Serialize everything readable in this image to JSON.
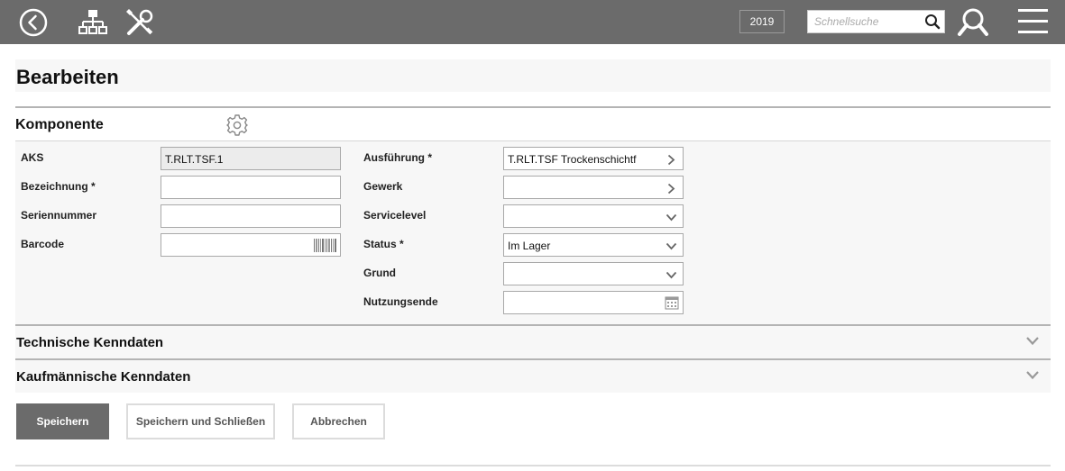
{
  "topbar": {
    "year": "2019",
    "search_placeholder": "Schnellsuche",
    "icons": [
      "back-circle-icon",
      "hierarchy-icon",
      "tools-icon",
      "search-icon",
      "advanced-search-icon",
      "menu-icon"
    ]
  },
  "page": {
    "title": "Bearbeiten"
  },
  "komponente": {
    "title": "Komponente",
    "fields_left": [
      {
        "label": "AKS",
        "value": "T.RLT.TSF.1"
      },
      {
        "label": "Bezeichnung *",
        "value": ""
      },
      {
        "label": "Seriennummer",
        "value": ""
      },
      {
        "label": "Barcode",
        "value": ""
      }
    ],
    "fields_right": [
      {
        "label": "Ausführung *",
        "value": "T.RLT.TSF Trockenschichtf"
      },
      {
        "label": "Gewerk",
        "value": ""
      },
      {
        "label": "Servicelevel",
        "value": ""
      },
      {
        "label": "Status *",
        "value": "Im Lager"
      },
      {
        "label": "Grund",
        "value": ""
      },
      {
        "label": "Nutzungsende",
        "value": ""
      }
    ]
  },
  "sections": {
    "technische": "Technische Kenndaten",
    "kaufmaennische": "Kaufmännische Kenndaten"
  },
  "buttons": {
    "save": "Speichern",
    "save_close": "Speichern und Schließen",
    "cancel": "Abbrechen"
  },
  "colors": {
    "topbar": "#6b6b6b",
    "panel": "#f7f7f7",
    "primary_button": "#6b6b6b"
  }
}
